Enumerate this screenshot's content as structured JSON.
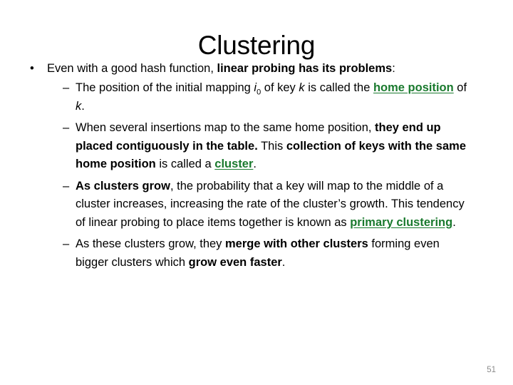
{
  "slide": {
    "title": "Clustering",
    "page_number": "51",
    "accent_color": "#1a7a2e",
    "text_color": "#000000",
    "page_number_color": "#8a8a8a",
    "background_color": "#ffffff"
  },
  "bullets": {
    "level1_marker": "•",
    "level2_marker": "–",
    "main": {
      "part1": "Even with a good hash function, ",
      "emphasis": "linear probing has its problems",
      "part2": ":"
    },
    "items": [
      {
        "id": "home-position",
        "seg1": "The position of the initial mapping ",
        "var_i": "i",
        "var_i_sub": "0",
        "seg2": " of key ",
        "var_k": "k",
        "seg3": " is called the ",
        "link": "home position",
        "seg4": " of ",
        "var_k2": "k",
        "seg5": "."
      },
      {
        "id": "cluster-definition",
        "seg1": "When several insertions map to the same home position, ",
        "bold1": "they end up placed contiguously in the table.",
        "seg2": "  This ",
        "bold2": "collection of keys with the same home position",
        "seg3": " is called a ",
        "link": "cluster",
        "seg4": "."
      },
      {
        "id": "primary-clustering",
        "bold1": "As clusters grow",
        "seg1": ", the probability that a key will map to the middle of a cluster increases, increasing the rate of the cluster’s growth.  This tendency of linear probing to place items together is known as ",
        "link": "primary clustering",
        "seg2": "."
      },
      {
        "id": "merging-clusters",
        "seg1": "As these clusters grow, they ",
        "bold1": "merge with other clusters",
        "seg2": " forming even bigger clusters which ",
        "bold2": "grow even faster",
        "seg3": "."
      }
    ]
  }
}
